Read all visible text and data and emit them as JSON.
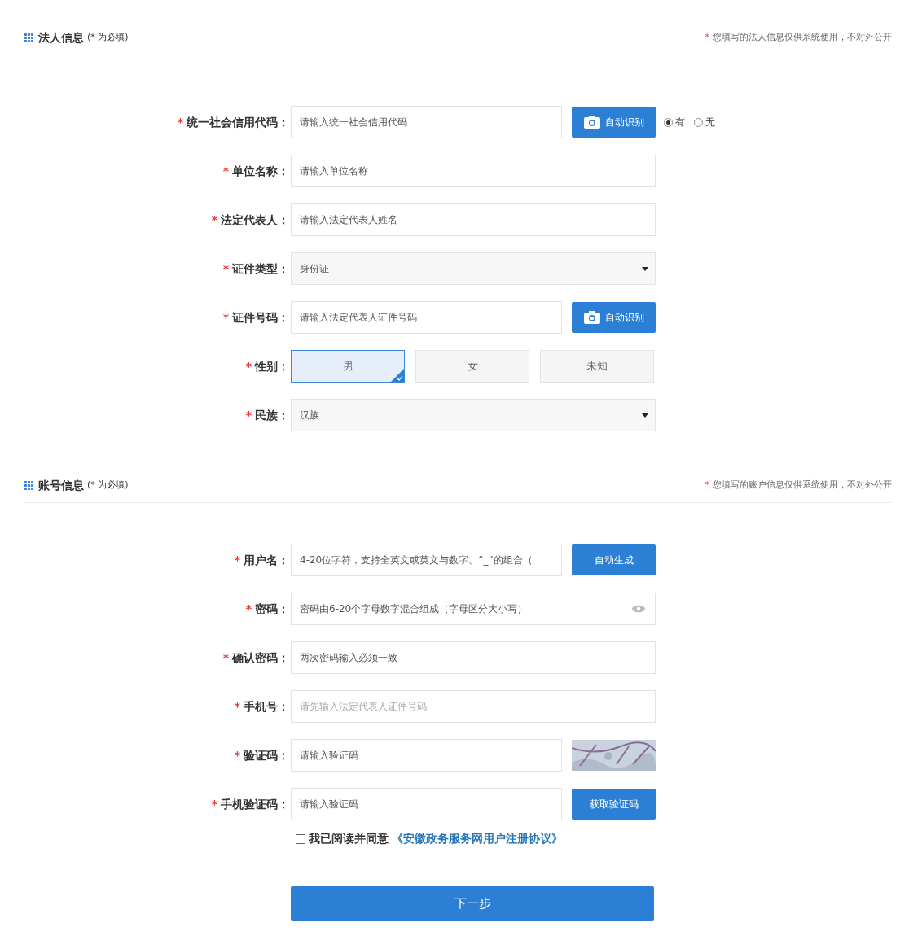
{
  "sections": [
    {
      "title": "法人信息",
      "hint": "(* 为必填)",
      "notice_mark": "*",
      "notice": "您填写的法人信息仅供系统使用，不对外公开",
      "fields": [
        {
          "kind": "input",
          "mark": "*",
          "label": "统一社会信用代码：",
          "placeholder": "请输入统一社会信用代码",
          "disabled": false,
          "button": {
            "kind": "scan",
            "label": "自动识别"
          },
          "radios": [
            {
              "label": "有",
              "selected": true
            },
            {
              "label": "无",
              "selected": false
            }
          ]
        },
        {
          "kind": "input",
          "mark": "*",
          "label": "单位名称：",
          "placeholder": "请输入单位名称",
          "disabled": false
        },
        {
          "kind": "input",
          "mark": "*",
          "label": "法定代表人：",
          "placeholder": "请输入法定代表人姓名",
          "disabled": false
        },
        {
          "kind": "select",
          "mark": "*",
          "label": "证件类型：",
          "value": "身份证",
          "disabled": false
        },
        {
          "kind": "input",
          "mark": "*",
          "label": "证件号码：",
          "placeholder": "请输入法定代表人证件号码",
          "disabled": false,
          "button": {
            "kind": "scan",
            "label": "自动识别"
          }
        },
        {
          "kind": "choice",
          "mark": "*",
          "label": "性别：",
          "disabled": false,
          "options": [
            {
              "label": "男",
              "selected": true
            },
            {
              "label": "女",
              "selected": false
            },
            {
              "label": "未知",
              "selected": false
            }
          ]
        },
        {
          "kind": "select",
          "mark": "*",
          "label": "民族：",
          "value": "汉族",
          "disabled": false
        }
      ]
    },
    {
      "title": "账号信息",
      "hint": "(* 为必填)",
      "notice_mark": "*",
      "notice": "您填写的账户信息仅供系统使用，不对外公开",
      "fields": [
        {
          "kind": "input",
          "mark": "*",
          "label": "用户名：",
          "placeholder": "4-20位字符，支持全英文或英文与数字、“_”的组合（",
          "disabled": false,
          "button": {
            "kind": "plain",
            "label": "自动生成"
          }
        },
        {
          "kind": "password",
          "mark": "*",
          "label": "密码：",
          "placeholder": "密码由6-20个字母数字混合组成（字母区分大小写）",
          "disabled": false
        },
        {
          "kind": "input",
          "mark": "*",
          "label": "确认密码：",
          "placeholder": "两次密码输入必须一致",
          "disabled": false
        },
        {
          "kind": "input",
          "mark": "*",
          "label": "手机号：",
          "placeholder": "请先输入法定代表人证件号码",
          "disabled": true
        },
        {
          "kind": "captcha",
          "mark": "*",
          "label": "验证码：",
          "placeholder": "请输入验证码",
          "disabled": false
        },
        {
          "kind": "input",
          "mark": "*",
          "label": "手机验证码：",
          "placeholder": "请输入验证码",
          "disabled": false,
          "button": {
            "kind": "plain",
            "label": "获取验证码"
          }
        }
      ],
      "agreement": {
        "checked": false,
        "text": "我已阅读并同意",
        "link": "《安徽政务服务网用户注册协议》"
      },
      "submit": "下一步"
    }
  ]
}
